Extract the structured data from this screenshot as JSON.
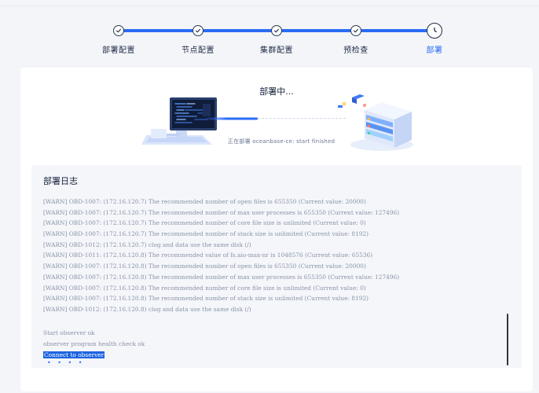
{
  "stepper": {
    "steps": [
      {
        "label": "部署配置",
        "state": "done"
      },
      {
        "label": "节点配置",
        "state": "done"
      },
      {
        "label": "集群配置",
        "state": "done"
      },
      {
        "label": "预检查",
        "state": "done"
      },
      {
        "label": "部署",
        "state": "current"
      }
    ],
    "accent_color": "#2b6cf5"
  },
  "deploy": {
    "title": "部署中...",
    "status_text": "正在部署 oceanbase-ce: start finished"
  },
  "log": {
    "title": "部署日志",
    "lines": [
      "[WARN] OBD-1007: (172.16.120.7) The recommended number of open files is 655350 (Current value: 20000)",
      "[WARN] OBD-1007: (172.16.120.7) The recommended number of max user processes is 655350 (Current value: 127496)",
      "[WARN] OBD-1007: (172.16.120.7) The recommended number of core file size is unlimited (Current value: 0)",
      "[WARN] OBD-1007: (172.16.120.7) The recommended number of stack size is unlimited (Current value: 8192)",
      "[WARN] OBD-1012: (172.16.120.7) clog and data use the same disk (/)",
      "[WARN] OBD-1011: (172.16.120.8) The recommended value of fs.aio-max-nr is 1048576 (Current value: 65536)",
      "[WARN] OBD-1007: (172.16.120.8) The recommended number of open files is 655350 (Current value: 20000)",
      "[WARN] OBD-1007: (172.16.120.8) The recommended number of max user processes is 655350 (Current value: 127496)",
      "[WARN] OBD-1007: (172.16.120.8) The recommended number of core file size is unlimited (Current value: 0)",
      "[WARN] OBD-1007: (172.16.120.8) The recommended number of stack size is unlimited (Current value: 8192)",
      "[WARN] OBD-1012: (172.16.120.8) clog and data use the same disk (/)"
    ],
    "tail": [
      "Start observer ok",
      "observer program health check ok"
    ],
    "highlighted": "Connect to observer",
    "loading_dots": "• • • •"
  }
}
